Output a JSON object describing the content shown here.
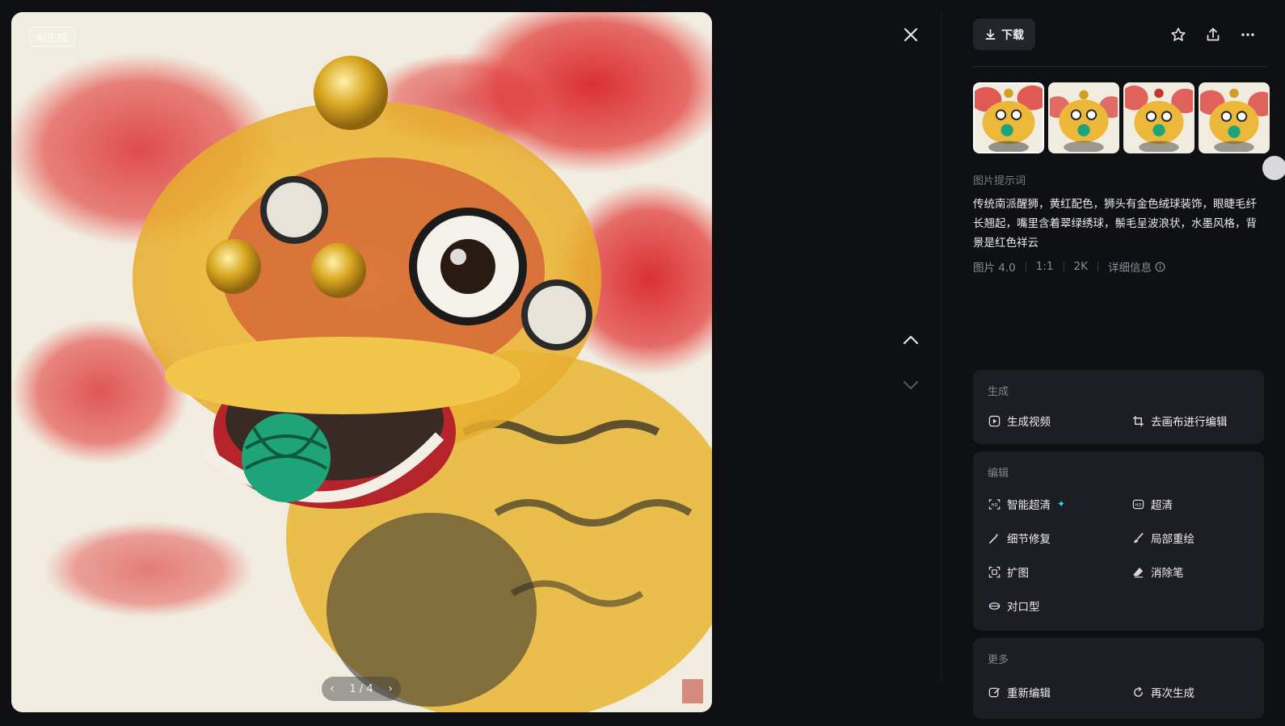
{
  "viewer": {
    "badge": "AI生成",
    "pager": {
      "current": "1 / 4",
      "prev_icon": "chevron-left-icon",
      "next_icon": "chevron-right-icon"
    }
  },
  "controls": {
    "close_icon": "close-icon",
    "up_icon": "chevron-up-icon",
    "down_icon": "chevron-down-icon"
  },
  "panel": {
    "download_label": "下载",
    "actions": [
      "star-icon",
      "share-icon",
      "more-icon"
    ],
    "thumbnails_count": 4,
    "prompt_label": "图片提示词",
    "prompt_text": "传统南派醒狮，黄红配色，狮头有金色绒球装饰，眼睫毛纤长翘起，嘴里含着翠绿绣球，鬃毛呈波浪状，水墨风格，背景是红色祥云",
    "meta": {
      "model": "图片 4.0",
      "ratio": "1:1",
      "resolution": "2K",
      "details": "详细信息"
    },
    "sections": {
      "generate": {
        "title": "生成",
        "items": {
          "video": "生成视频",
          "canvas": "去画布进行编辑"
        }
      },
      "edit": {
        "title": "编辑",
        "items": {
          "smart_hd": "智能超清",
          "hd": "超清",
          "detail_fix": "细节修复",
          "inpaint": "局部重绘",
          "expand": "扩图",
          "eraser": "消除笔",
          "lipsync": "对口型"
        }
      },
      "more": {
        "title": "更多",
        "items": {
          "reedit": "重新编辑",
          "regenerate": "再次生成"
        }
      }
    }
  },
  "colors": {
    "background": "#0f1014",
    "card": "#1d1e24",
    "accent": "#2fd6ff"
  }
}
